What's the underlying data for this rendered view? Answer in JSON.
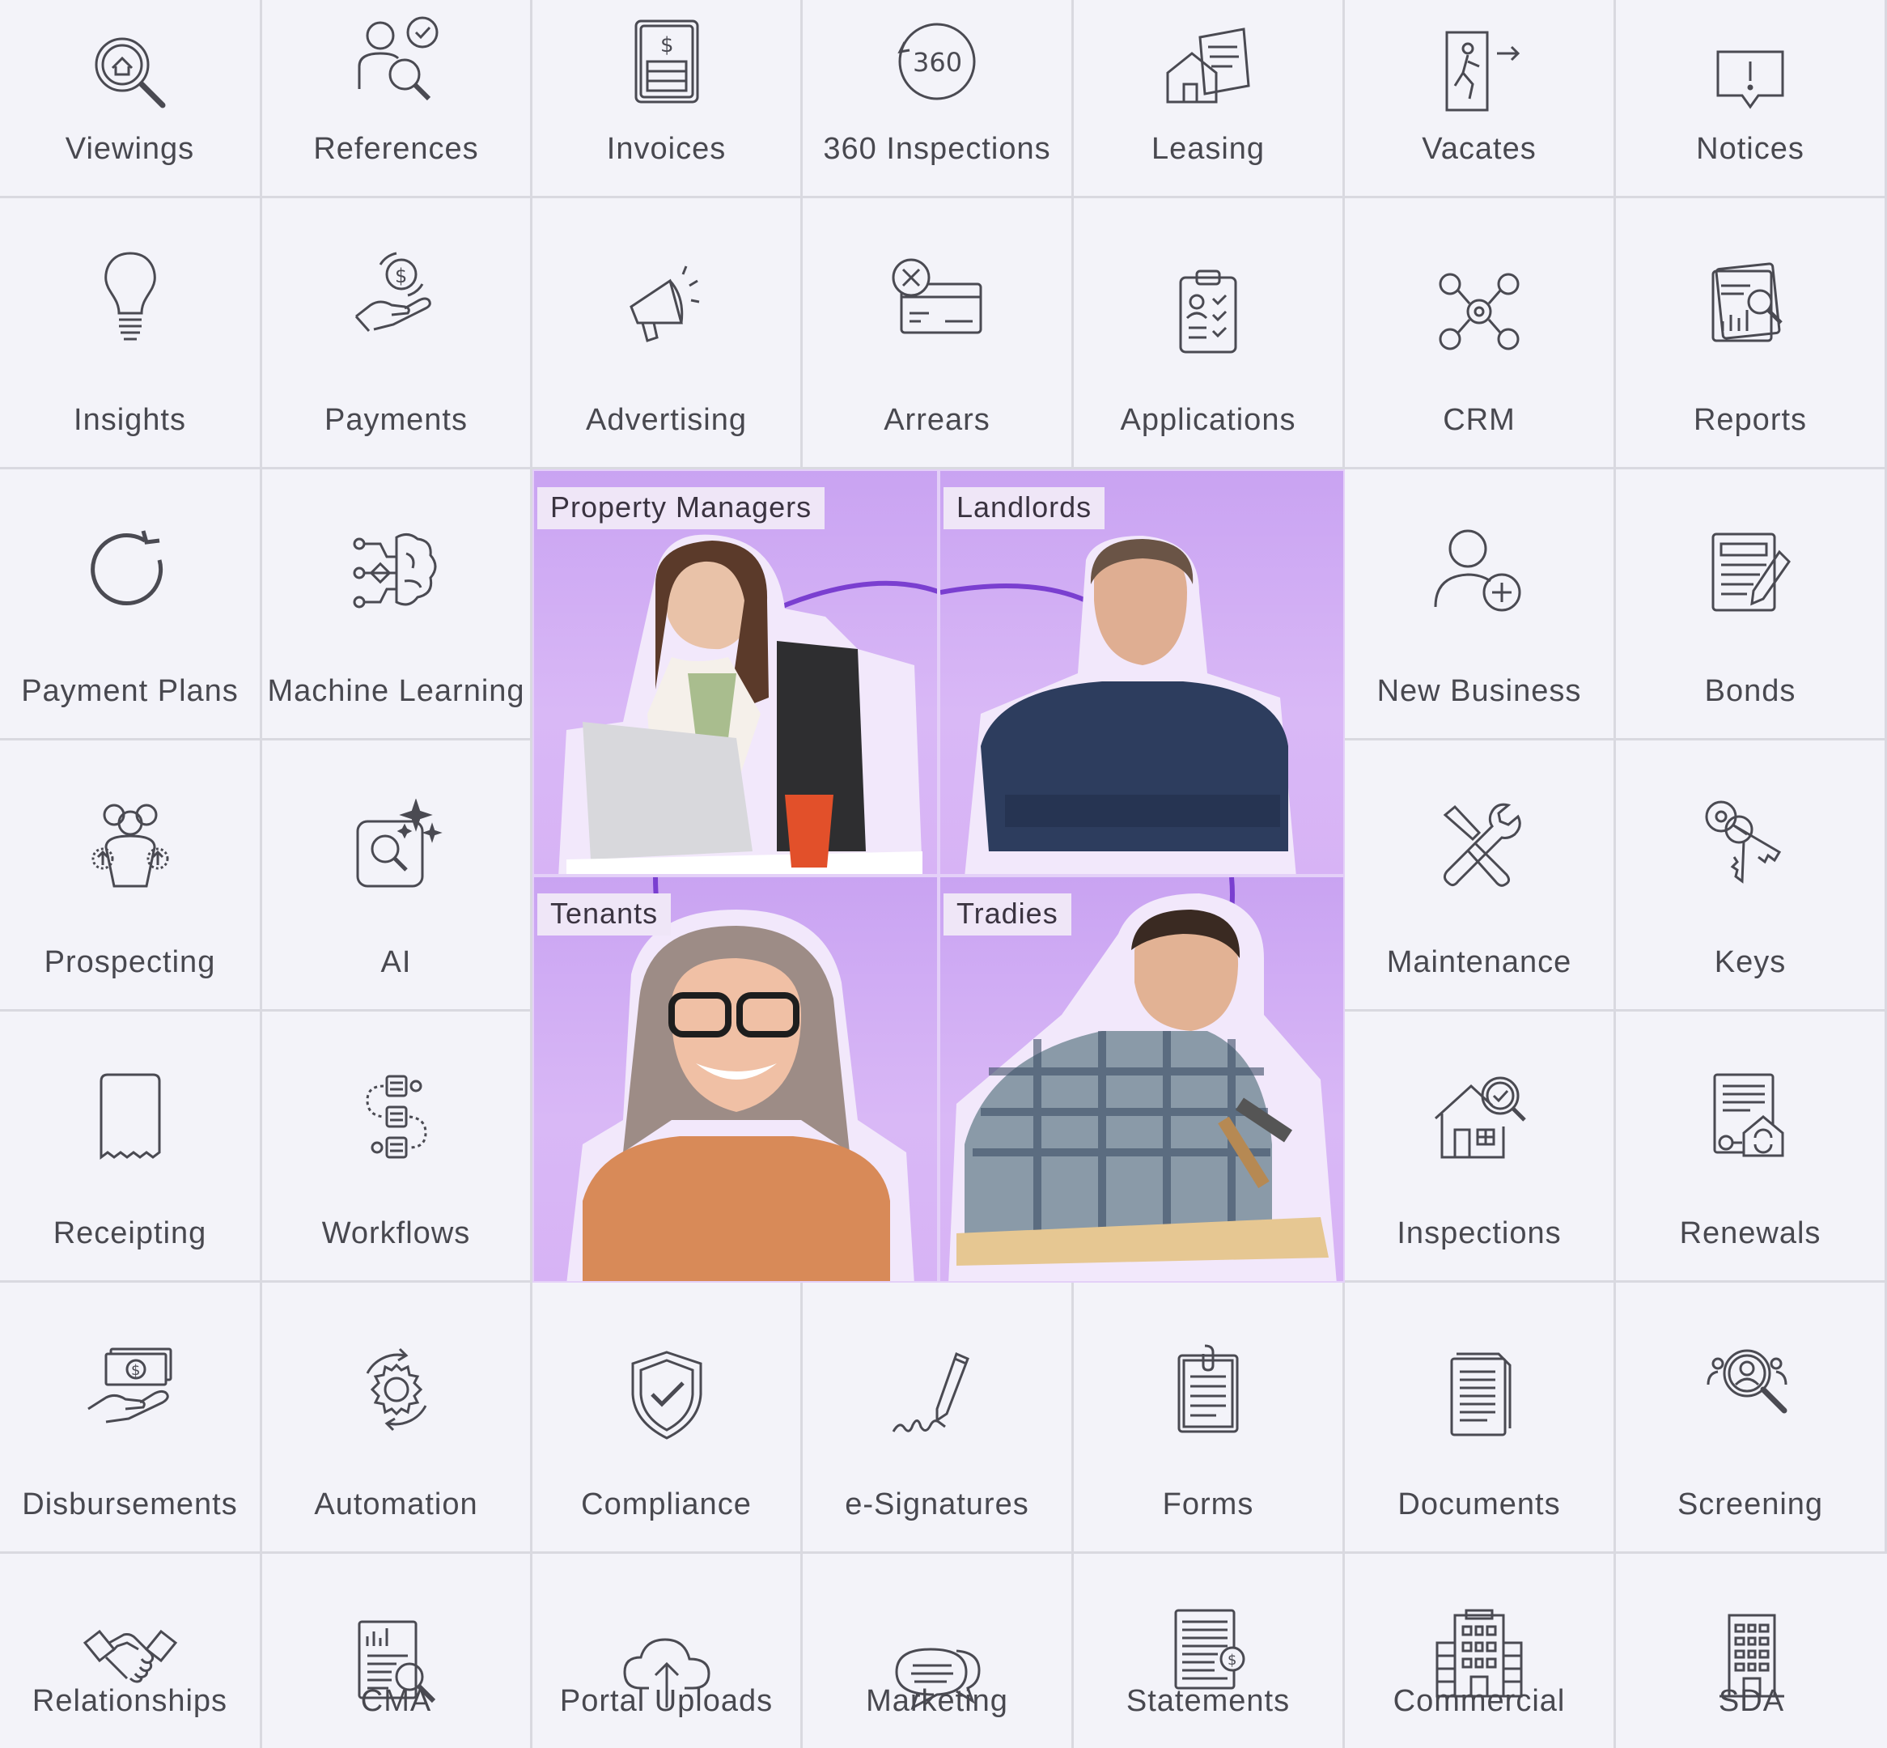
{
  "features": {
    "viewings": "Viewings",
    "references": "References",
    "invoices": "Invoices",
    "inspections360": "360 Inspections",
    "leasing": "Leasing",
    "vacates": "Vacates",
    "notices": "Notices",
    "insights": "Insights",
    "payments": "Payments",
    "advertising": "Advertising",
    "arrears": "Arrears",
    "applications": "Applications",
    "crm": "CRM",
    "reports": "Reports",
    "payment_plans": "Payment Plans",
    "machine_learning": "Machine Learning",
    "new_business": "New Business",
    "bonds": "Bonds",
    "prospecting": "Prospecting",
    "ai": "AI",
    "maintenance": "Maintenance",
    "keys": "Keys",
    "receipting": "Receipting",
    "workflows": "Workflows",
    "inspections": "Inspections",
    "renewals": "Renewals",
    "disbursements": "Disbursements",
    "automation": "Automation",
    "compliance": "Compliance",
    "e_signatures": "e-Signatures",
    "forms": "Forms",
    "documents": "Documents",
    "screening": "Screening",
    "relationships": "Relationships",
    "cma": "CMA",
    "portal_uploads": "Portal Uploads",
    "marketing": "Marketing",
    "statements": "Statements",
    "commercial": "Commercial",
    "sda": "SDA"
  },
  "personas": {
    "property_managers": "Property Managers",
    "landlords": "Landlords",
    "tenants": "Tenants",
    "tradies": "Tradies"
  },
  "colors": {
    "background": "#f3f3f9",
    "grid_line": "#d9d9e0",
    "label_text": "#48484f",
    "icon_stroke": "#4a4a52",
    "persona_bg": "#c9a3f2",
    "ring": "#7a3fd0"
  }
}
